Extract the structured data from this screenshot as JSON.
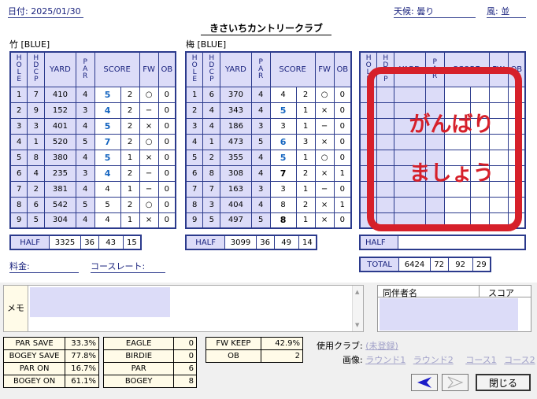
{
  "header": {
    "date_label": "日付: 2025/01/30",
    "weather_label": "天候: 曇り",
    "wind_label": "風: 並",
    "course_name": "きさいちカントリークラブ"
  },
  "columns": {
    "hole": [
      "H",
      "O",
      "L",
      "E"
    ],
    "hdcp": [
      "H",
      "D",
      "C",
      "P"
    ],
    "yard": "YARD",
    "par": [
      "P",
      "A",
      "R"
    ],
    "score": "SCORE",
    "fw": "FW",
    "ob": "OB"
  },
  "front": {
    "tee_label": "竹 [BLUE]",
    "rows": [
      {
        "hole": "1",
        "hdcp": "7",
        "yard": "410",
        "par": "4",
        "score": "5",
        "putt": "2",
        "fw": "○",
        "ob": "0",
        "style": "b"
      },
      {
        "hole": "2",
        "hdcp": "9",
        "yard": "152",
        "par": "3",
        "score": "4",
        "putt": "2",
        "fw": "−",
        "ob": "0",
        "style": "b"
      },
      {
        "hole": "3",
        "hdcp": "3",
        "yard": "401",
        "par": "4",
        "score": "5",
        "putt": "2",
        "fw": "×",
        "ob": "0",
        "style": "b"
      },
      {
        "hole": "4",
        "hdcp": "1",
        "yard": "520",
        "par": "5",
        "score": "7",
        "putt": "2",
        "fw": "○",
        "ob": "0",
        "style": "b"
      },
      {
        "hole": "5",
        "hdcp": "8",
        "yard": "380",
        "par": "4",
        "score": "5",
        "putt": "1",
        "fw": "×",
        "ob": "0",
        "style": "b"
      },
      {
        "hole": "6",
        "hdcp": "4",
        "yard": "235",
        "par": "3",
        "score": "4",
        "putt": "2",
        "fw": "−",
        "ob": "0",
        "style": "b"
      },
      {
        "hole": "7",
        "hdcp": "2",
        "yard": "381",
        "par": "4",
        "score": "4",
        "putt": "1",
        "fw": "−",
        "ob": "0",
        "style": "n"
      },
      {
        "hole": "8",
        "hdcp": "6",
        "yard": "542",
        "par": "5",
        "score": "5",
        "putt": "2",
        "fw": "○",
        "ob": "0",
        "style": "n"
      },
      {
        "hole": "9",
        "hdcp": "5",
        "yard": "304",
        "par": "4",
        "score": "4",
        "putt": "1",
        "fw": "×",
        "ob": "0",
        "style": "n"
      }
    ],
    "half": {
      "label": "HALF",
      "yard": "3325",
      "par": "36",
      "score": "43",
      "putt": "15"
    }
  },
  "back": {
    "tee_label": "梅 [BLUE]",
    "rows": [
      {
        "hole": "1",
        "hdcp": "6",
        "yard": "370",
        "par": "4",
        "score": "4",
        "putt": "2",
        "fw": "○",
        "ob": "0",
        "style": "n"
      },
      {
        "hole": "2",
        "hdcp": "4",
        "yard": "343",
        "par": "4",
        "score": "5",
        "putt": "1",
        "fw": "×",
        "ob": "0",
        "style": "b"
      },
      {
        "hole": "3",
        "hdcp": "4",
        "yard": "186",
        "par": "3",
        "score": "3",
        "putt": "1",
        "fw": "−",
        "ob": "0",
        "style": "n"
      },
      {
        "hole": "4",
        "hdcp": "1",
        "yard": "473",
        "par": "5",
        "score": "6",
        "putt": "3",
        "fw": "×",
        "ob": "0",
        "style": "b"
      },
      {
        "hole": "5",
        "hdcp": "2",
        "yard": "355",
        "par": "4",
        "score": "5",
        "putt": "1",
        "fw": "○",
        "ob": "0",
        "style": "b"
      },
      {
        "hole": "6",
        "hdcp": "8",
        "yard": "308",
        "par": "4",
        "score": "7",
        "putt": "2",
        "fw": "×",
        "ob": "1",
        "style": "k"
      },
      {
        "hole": "7",
        "hdcp": "7",
        "yard": "163",
        "par": "3",
        "score": "3",
        "putt": "1",
        "fw": "−",
        "ob": "0",
        "style": "n"
      },
      {
        "hole": "8",
        "hdcp": "3",
        "yard": "404",
        "par": "4",
        "score": "8",
        "putt": "2",
        "fw": "×",
        "ob": "1",
        "style": "n"
      },
      {
        "hole": "9",
        "hdcp": "5",
        "yard": "497",
        "par": "5",
        "score": "8",
        "putt": "1",
        "fw": "×",
        "ob": "0",
        "style": "k"
      }
    ],
    "half": {
      "label": "HALF",
      "yard": "3099",
      "par": "36",
      "score": "49",
      "putt": "14"
    }
  },
  "third": {
    "half_label": "HALF",
    "overlay_line1": "がんばり",
    "overlay_line2": "ましょう",
    "total": {
      "label": "TOTAL",
      "yard": "6424",
      "par": "72",
      "score": "92",
      "putt": "29"
    }
  },
  "fee_label": "料金:",
  "course_rate_label": "コースレート:",
  "memo_label": "メモ",
  "companions": {
    "name_header": "同伴者名",
    "score_header": "スコア"
  },
  "stats1": [
    {
      "k": "PAR SAVE",
      "v": "33.3%"
    },
    {
      "k": "BOGEY SAVE",
      "v": "77.8%"
    },
    {
      "k": "PAR ON",
      "v": "16.7%"
    },
    {
      "k": "BOGEY ON",
      "v": "61.1%"
    }
  ],
  "stats2": [
    {
      "k": "EAGLE",
      "v": "0"
    },
    {
      "k": "BIRDIE",
      "v": "0"
    },
    {
      "k": "PAR",
      "v": "6"
    },
    {
      "k": "BOGEY",
      "v": "8"
    }
  ],
  "stats3": [
    {
      "k": "FW KEEP",
      "v": "42.9%"
    },
    {
      "k": "OB",
      "v": "2"
    }
  ],
  "clubs": {
    "label": "使用クラブ:",
    "link": "(未登録)"
  },
  "images": {
    "label": "画像:",
    "links": [
      "ラウンド1",
      "ラウンド2",
      "コース1",
      "コース2"
    ]
  },
  "buttons": {
    "prev_icon": "left-arrow-icon",
    "next_icon": "right-arrow-icon",
    "close": "閉じる"
  },
  "colors": {
    "accent_red": "#d6202a",
    "header_blue": "#1a237e",
    "cell_shade": "#dcdcf8",
    "score_blue": "#1565c0"
  }
}
